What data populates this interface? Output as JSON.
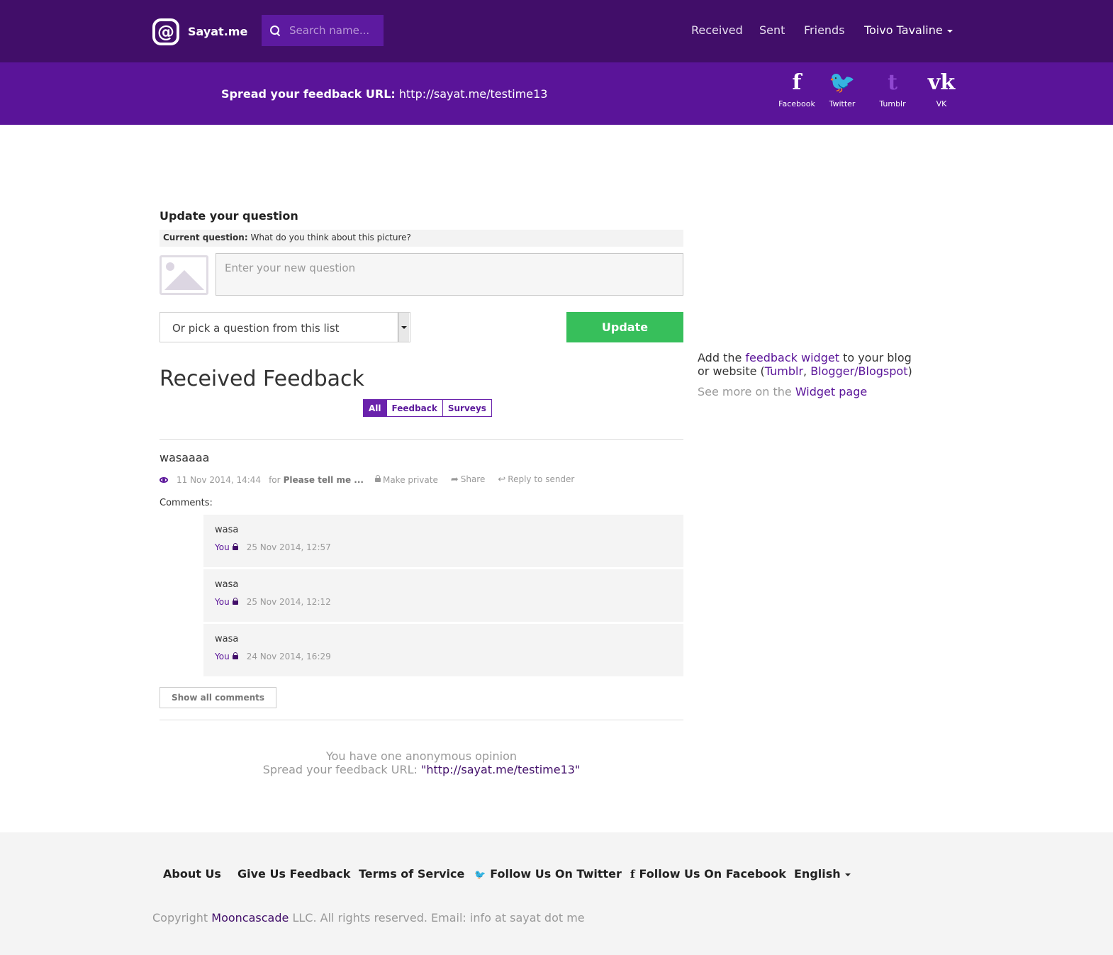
{
  "header": {
    "logo_glyph": "@",
    "logo_text": "Sayat.me",
    "search_placeholder": "Search name...",
    "nav": {
      "received": "Received",
      "sent": "Sent",
      "friends": "Friends",
      "user": "Toivo Tavaline"
    }
  },
  "sharebar": {
    "label": "Spread your feedback URL:",
    "url": "http://sayat.me/testime13",
    "social": [
      {
        "label": "Facebook",
        "glyph": "f",
        "icon": "facebook-icon"
      },
      {
        "label": "Twitter",
        "glyph": "🐦",
        "icon": "twitter-icon"
      },
      {
        "label": "Tumblr",
        "glyph": "t",
        "icon": "tumblr-icon"
      },
      {
        "label": "VK",
        "glyph": "vk",
        "icon": "vk-icon"
      }
    ]
  },
  "question": {
    "title": "Update your question",
    "current_label": "Current question:",
    "current_value": "What do you think about this picture?",
    "input_placeholder": "Enter your new question",
    "select_label": "Or pick a question from this list",
    "update_button": "Update"
  },
  "feedback": {
    "title": "Received Feedback",
    "filters": [
      "All",
      "Feedback",
      "Surveys"
    ],
    "active_filter": "All",
    "item": {
      "text": "wasaaaa",
      "date": "11 Nov 2014, 14:44",
      "for_label": "for",
      "for_value": "Please tell me ...",
      "make_private": "Make private",
      "share": "Share",
      "reply": "Reply to sender",
      "comments_label": "Comments:",
      "comments": [
        {
          "text": "wasa",
          "author": "You",
          "date": "25 Nov 2014, 12:57"
        },
        {
          "text": "wasa",
          "author": "You",
          "date": "25 Nov 2014, 12:12"
        },
        {
          "text": "wasa",
          "author": "You",
          "date": "24 Nov 2014, 16:29"
        }
      ],
      "show_all": "Show all comments"
    },
    "anon_line1": "You have one anonymous opinion",
    "anon_line2_prefix": "Spread your feedback URL:",
    "anon_url": "\"http://sayat.me/testime13\""
  },
  "sidebar": {
    "add_the": "Add the",
    "feedback_widget": "feedback widget",
    "to_blog": "to your blog or website (",
    "tumblr": "Tumblr",
    "comma": ",",
    "blogger": "Blogger/Blogspot",
    "close": ")",
    "see_more": "See more on the",
    "widget_page": "Widget page"
  },
  "footer": {
    "about": "About Us",
    "give_feedback": "Give Us Feedback",
    "tos": "Terms of Service",
    "twitter": "Follow Us On Twitter",
    "facebook": "Follow Us On Facebook",
    "language": "English",
    "copyright_prefix": "Copyright",
    "company": "Mooncascade",
    "copyright_suffix": "LLC. All rights reserved. Email: info at sayat dot me"
  },
  "colors": {
    "navbar": "#410e69",
    "sharebar": "#5a1499",
    "accent": "#5a1499",
    "update_button": "#37bf5b"
  }
}
